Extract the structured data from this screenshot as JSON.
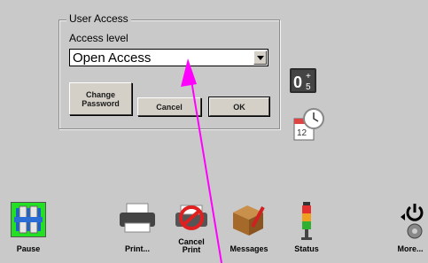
{
  "dialog": {
    "group_title": "User Access",
    "access_level_label": "Access level",
    "access_level_value": "Open Access",
    "buttons": {
      "change_password": "Change Password",
      "cancel": "Cancel",
      "ok": "OK"
    }
  },
  "side_icons": [
    "counter-icon",
    "calendar-clock-icon"
  ],
  "toolbar": {
    "items": [
      {
        "label": "Pause",
        "icon": "pause-printhead-icon",
        "active": true
      },
      {
        "label": "Print...",
        "icon": "printer-icon"
      },
      {
        "label": "Cancel Print",
        "icon": "cancel-print-icon"
      },
      {
        "label": "Messages",
        "icon": "messages-box-icon"
      },
      {
        "label": "Status",
        "icon": "status-light-icon"
      },
      {
        "label": "More...",
        "icon": "more-power-icon"
      }
    ]
  },
  "annotation": {
    "color": "#ff00ff"
  }
}
